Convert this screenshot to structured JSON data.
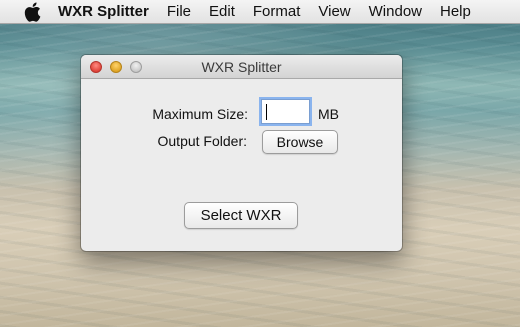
{
  "menubar": {
    "app_name": "WXR Splitter",
    "items": [
      "File",
      "Edit",
      "Format",
      "View",
      "Window",
      "Help"
    ]
  },
  "window": {
    "title": "WXR Splitter",
    "max_size_label": "Maximum Size:",
    "max_size_value": "",
    "max_size_unit": "MB",
    "output_folder_label": "Output Folder:",
    "browse_label": "Browse",
    "select_label": "Select WXR"
  },
  "colors": {
    "close": "#e0443a",
    "minimize": "#e0a526",
    "zoom": "#c9c9c9",
    "focus_ring": "#8ab4ee"
  },
  "icons": [
    "apple-icon"
  ]
}
